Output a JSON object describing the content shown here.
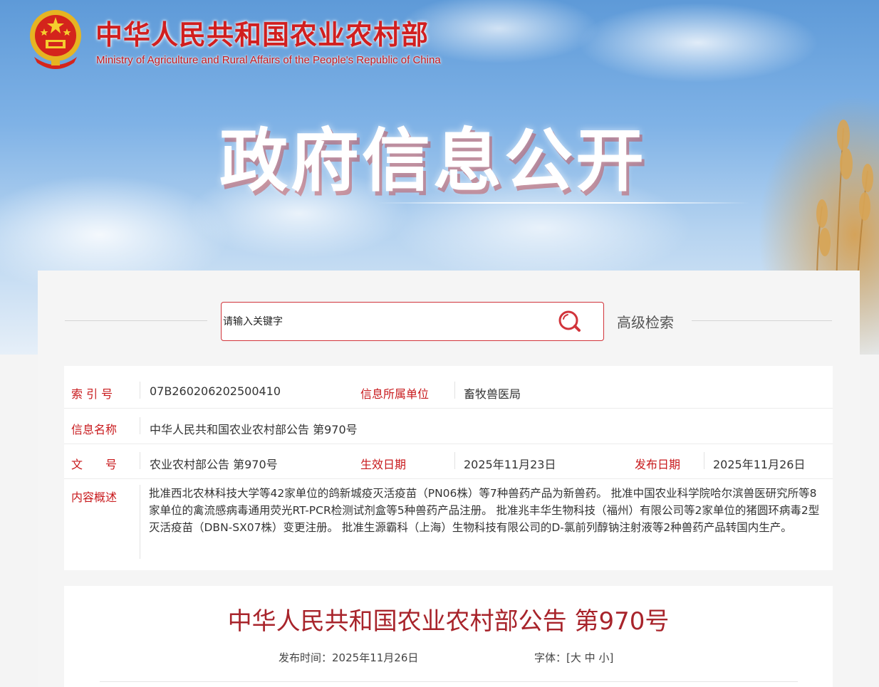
{
  "header": {
    "ministry_cn": "中华人民共和国农业农村部",
    "ministry_en": "Ministry of Agriculture and Rural Affairs of the People's Republic of China",
    "banner_title": "政府信息公开"
  },
  "search": {
    "placeholder": "请输入关键字",
    "advanced_label": "高级检索",
    "icon": "search-icon"
  },
  "info": {
    "index_label": "索 引 号",
    "index_value": "07B260206202500410",
    "unit_label": "信息所属单位",
    "unit_value": "畜牧兽医局",
    "name_label": "信息名称",
    "name_value": "中华人民共和国农业农村部公告 第970号",
    "docno_label": "文　　号",
    "docno_value": "农业农村部公告 第970号",
    "effective_label": "生效日期",
    "effective_value": "2025年11月23日",
    "publish_label": "发布日期",
    "publish_value": "2025年11月26日",
    "summary_label": "内容概述",
    "summary_value": "批准西北农林科技大学等42家单位的鸽新城疫灭活疫苗（PN06株）等7种兽药产品为新兽药。 批准中国农业科学院哈尔滨兽医研究所等8家单位的禽流感病毒通用荧光RT-PCR检测试剂盒等5种兽药产品注册。 批准兆丰华生物科技（福州）有限公司等2家单位的猪圆环病毒2型灭活疫苗（DBN-SX07株）变更注册。 批准生源霸科（上海）生物科技有限公司的D-氯前列醇钠注射液等2种兽药产品转国内生产。"
  },
  "article": {
    "title": "中华人民共和国农业农村部公告 第970号",
    "publish_time_label": "发布时间：",
    "publish_time_value": "2025年11月26日",
    "font_label": "字体：",
    "font_open": "[",
    "font_large": "大",
    "font_medium": "中",
    "font_small": "小",
    "font_close": "]"
  },
  "colors": {
    "accent_red": "#c8191c",
    "title_red": "#a8242b",
    "search_border": "#d1343b"
  }
}
